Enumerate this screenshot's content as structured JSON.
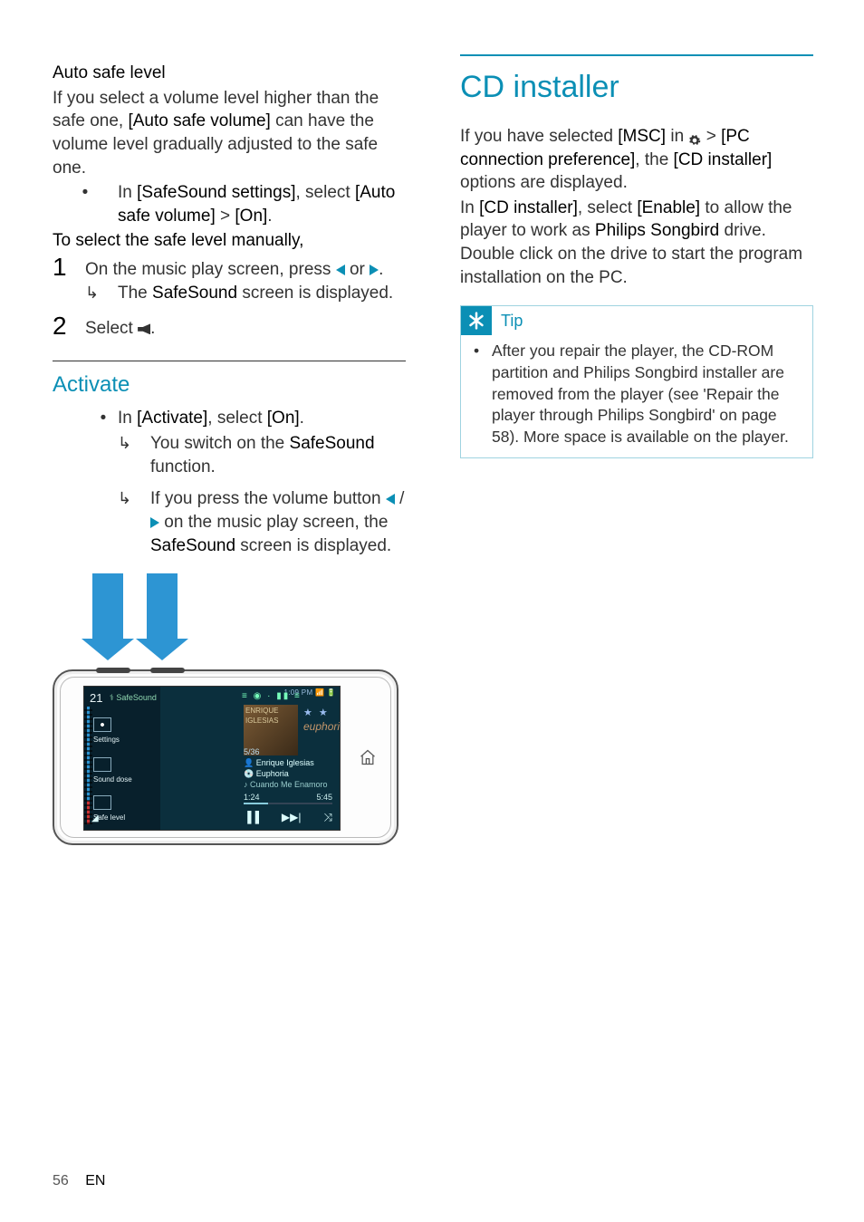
{
  "left": {
    "h_auto": "Auto safe level",
    "p_auto_1a": "If you select a volume level higher than the safe one, ",
    "p_auto_1b": "[Auto safe volume]",
    "p_auto_1c": " can have the volume level gradually adjusted to the safe one.",
    "b1a": "In ",
    "b1b": "[SafeSound settings]",
    "b1c": ", select ",
    "b1d": "[Auto safe volume]",
    "b1e": " > ",
    "b1f": "[On]",
    "b1g": ".",
    "h_manual": "To select the safe level manually,",
    "s1a": "On the music play screen, press ",
    "s1b": " or ",
    "s1c": ".",
    "s1res_a": "The ",
    "s1res_b": "SafeSound",
    "s1res_c": " screen is displayed.",
    "s2a": "Select ",
    "s2b": ".",
    "h_activate": "Activate",
    "a1a": "In ",
    "a1b": "[Activate]",
    "a1c": ", select ",
    "a1d": "[On]",
    "a1e": ".",
    "a1res_a": "You switch on the ",
    "a1res_b": "SafeSound",
    "a1res_c": " function.",
    "a2res_a": "If you press the volume button ",
    "a2res_b": " / ",
    "a2res_c": " on the music play screen, the ",
    "a2res_d": "SafeSound",
    "a2res_e": " screen is displayed."
  },
  "device": {
    "vol": "21",
    "ss": "SafeSound",
    "time": "1:09 PM",
    "m1": "Settings",
    "m2": "Sound dose",
    "m3": "Safe level",
    "count": "5/36",
    "artist": "Enrique Iglesias",
    "track": "Euphoria",
    "next": "Cuando Me Enamoro",
    "album": "euphoria",
    "t1": "1:24",
    "t2": "5:45",
    "stars": "★ ★",
    "tabs": "≡  ◉  ·  ▮▮      ≡",
    "ctrls_pause": "▐▐",
    "ctrls_next": "▶▶|",
    "ctrls_shuffle": "⤨"
  },
  "right": {
    "h_cd": "CD installer",
    "p1a": "If you have selected ",
    "p1b": "[MSC]",
    "p1c": " in ",
    "p1d": " > ",
    "p1e": "[PC connection preference]",
    "p1f": ", the ",
    "p1g": "[CD installer]",
    "p1h": " options are displayed.",
    "p2a": "In ",
    "p2b": "[CD installer]",
    "p2c": ", select ",
    "p2d": "[Enable]",
    "p2e": " to allow the player to work as ",
    "p2f": "Philips Songbird",
    "p2g": " drive. Double click on the drive to start the program installation on the PC.",
    "tip_label": "Tip",
    "tip_body": "After you repair the player, the CD-ROM partition and Philips Songbird installer are removed from the player (see 'Repair the player through Philips Songbird' on page 58). More space is available on the player."
  },
  "footer": {
    "page": "56",
    "lang": "EN"
  }
}
